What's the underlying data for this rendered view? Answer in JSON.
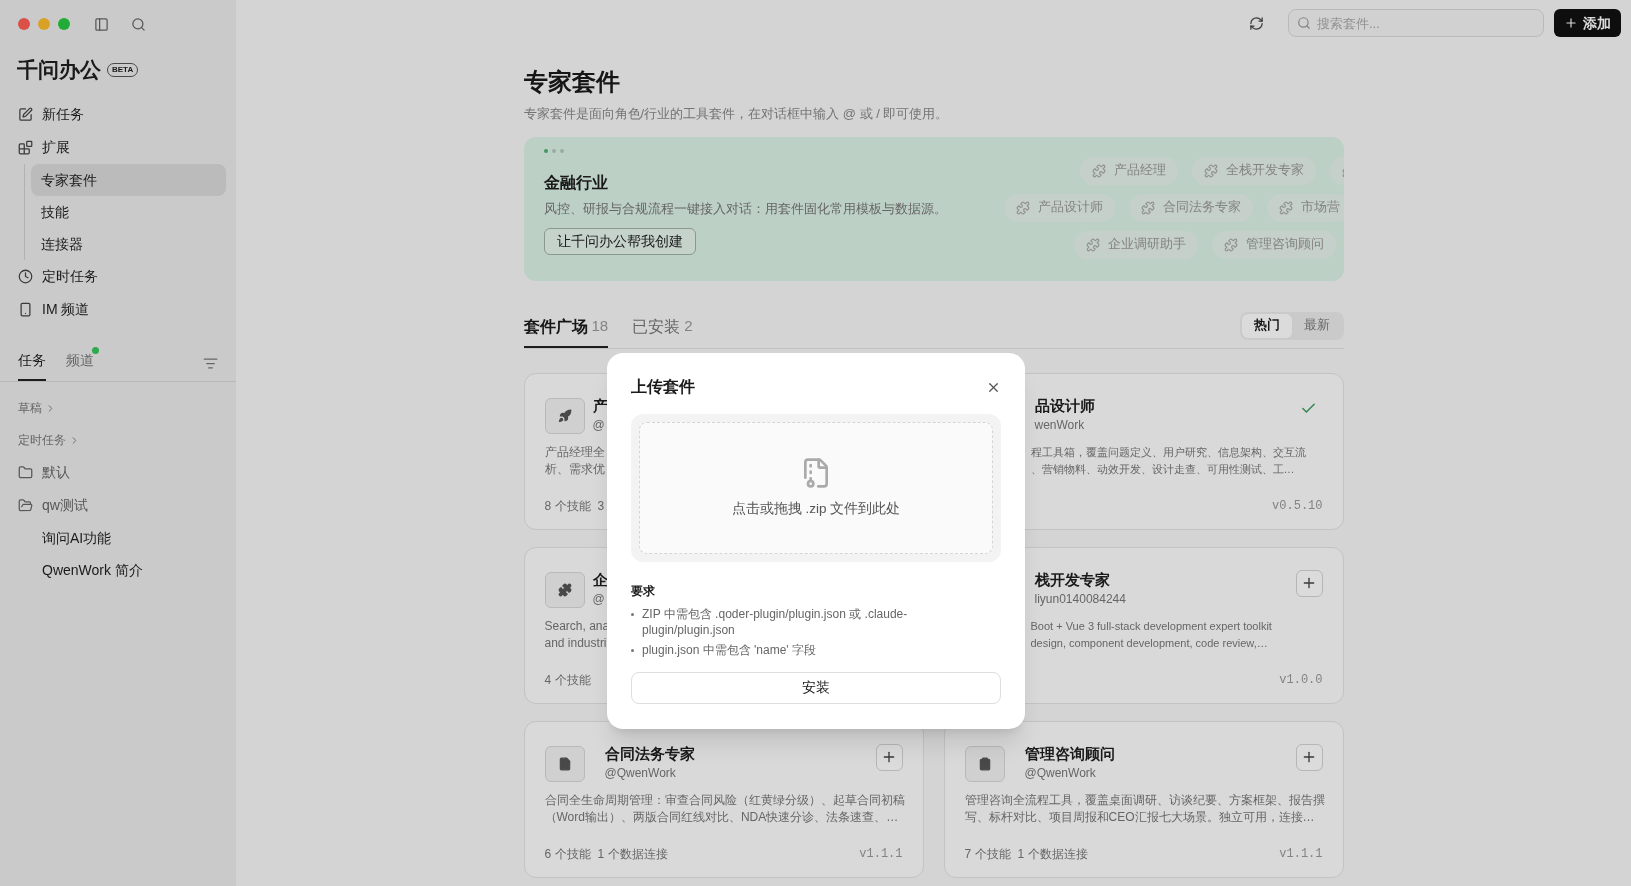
{
  "sidebar": {
    "app_title": "千问办公",
    "badge": "BETA",
    "nav": [
      {
        "label": "新任务"
      },
      {
        "label": "扩展",
        "expanded": true,
        "children": [
          {
            "label": "专家套件",
            "selected": true
          },
          {
            "label": "技能",
            "selected": false
          },
          {
            "label": "连接器",
            "selected": false
          }
        ]
      },
      {
        "label": "定时任务"
      },
      {
        "label": "IM 频道"
      }
    ],
    "tabs": [
      {
        "label": "任务",
        "selected": true,
        "unread": false
      },
      {
        "label": "频道",
        "selected": false,
        "unread": true
      }
    ],
    "task_list": [
      {
        "kind": "section",
        "label": "草稿"
      },
      {
        "kind": "section",
        "label": "定时任务"
      },
      {
        "kind": "folder",
        "label": "默认",
        "expanded": false
      },
      {
        "kind": "folder",
        "label": "qw测试",
        "expanded": true,
        "children": [
          {
            "label": "询问AI功能"
          },
          {
            "label": "QwenWork 简介"
          }
        ]
      }
    ]
  },
  "toolbar": {
    "search": {
      "placeholder": "搜索套件..."
    },
    "add_button": "添加"
  },
  "page": {
    "title": "专家套件",
    "subtitle": "专家套件是面向角色/行业的工具套件，在对话框中输入 @ 或 / 即可使用。"
  },
  "banner": {
    "dots": [
      {
        "selected": true
      },
      {
        "selected": false
      },
      {
        "selected": false
      }
    ],
    "title": "金融行业",
    "description": "风控、研报与合规流程一键接入对话：用套件固化常用模板与数据源。",
    "button": "让千问办公帮我创建",
    "chip_rows": [
      [
        {
          "kind": "label",
          "label": "产品经理"
        },
        {
          "kind": "label",
          "label": "全栈开发专家"
        },
        {
          "kind": "icon-only"
        }
      ],
      [
        {
          "kind": "label",
          "label": "产品设计师"
        },
        {
          "kind": "label",
          "label": "合同法务专家"
        },
        {
          "kind": "label",
          "label": "市场营"
        }
      ],
      [
        {
          "kind": "label",
          "label": "企业调研助手"
        },
        {
          "kind": "label",
          "label": "管理咨询顾问"
        }
      ]
    ]
  },
  "tabs": [
    {
      "label": "套件广场",
      "count": "18",
      "selected": true
    },
    {
      "label": "已安装",
      "count": "2",
      "selected": false
    }
  ],
  "sort": [
    {
      "label": "热门",
      "selected": true
    },
    {
      "label": "最新",
      "selected": false
    }
  ],
  "cards": [
    {
      "title": "产",
      "handle": "@",
      "description": [
        "产品经理全",
        "析、需求优"
      ],
      "meta": [
        "8 个技能",
        "3"
      ]
    },
    {
      "title": "品设计师",
      "handle": "wenWork",
      "description": [
        "程工具箱，覆盖问题定义、用户研究、信息架构、交互流",
        "、营销物料、动效开发、设计走查、可用性测试、工…"
      ],
      "version": "v0.5.10",
      "installed": true
    },
    {
      "title": "企",
      "handle": "@",
      "description": [
        "Search, ana",
        "and industri"
      ],
      "meta": [
        "4 个技能"
      ]
    },
    {
      "title": "栈开发专家",
      "handle": "liyun0140084244",
      "description": [
        "Boot + Vue 3 full-stack development expert toolkit",
        "design, component development, code review,…"
      ],
      "version": "v1.0.0",
      "installed": false
    },
    {
      "title": "合同法务专家",
      "handle": "@QwenWork",
      "description": [
        "合同全生命周期管理：审查合同风险（红黄绿分级）、起草合同初稿",
        "（Word输出）、两版合同红线对比、NDA快速分诊、法条速查、…"
      ],
      "meta": [
        "6 个技能",
        "1 个数据连接"
      ],
      "version": "v1.1.1",
      "installed": false
    },
    {
      "title": "管理咨询顾问",
      "handle": "@QwenWork",
      "description": [
        "管理咨询全流程工具，覆盖桌面调研、访谈纪要、方案框架、报告撰",
        "写、标杆对比、项目周报和CEO汇报七大场景。独立可用，连接…"
      ],
      "meta": [
        "7 个技能",
        "1 个数据连接"
      ],
      "version": "v1.1.1",
      "installed": false
    }
  ],
  "dialog": {
    "title": "上传套件",
    "dropzone": "点击或拖拽 .zip 文件到此处",
    "requirements_title": "要求",
    "requirements": [
      "ZIP 中需包含 .qoder-plugin/plugin.json 或 .claude-plugin/plugin.json",
      "plugin.json 中需包含 'name' 字段"
    ],
    "button": "安装"
  }
}
